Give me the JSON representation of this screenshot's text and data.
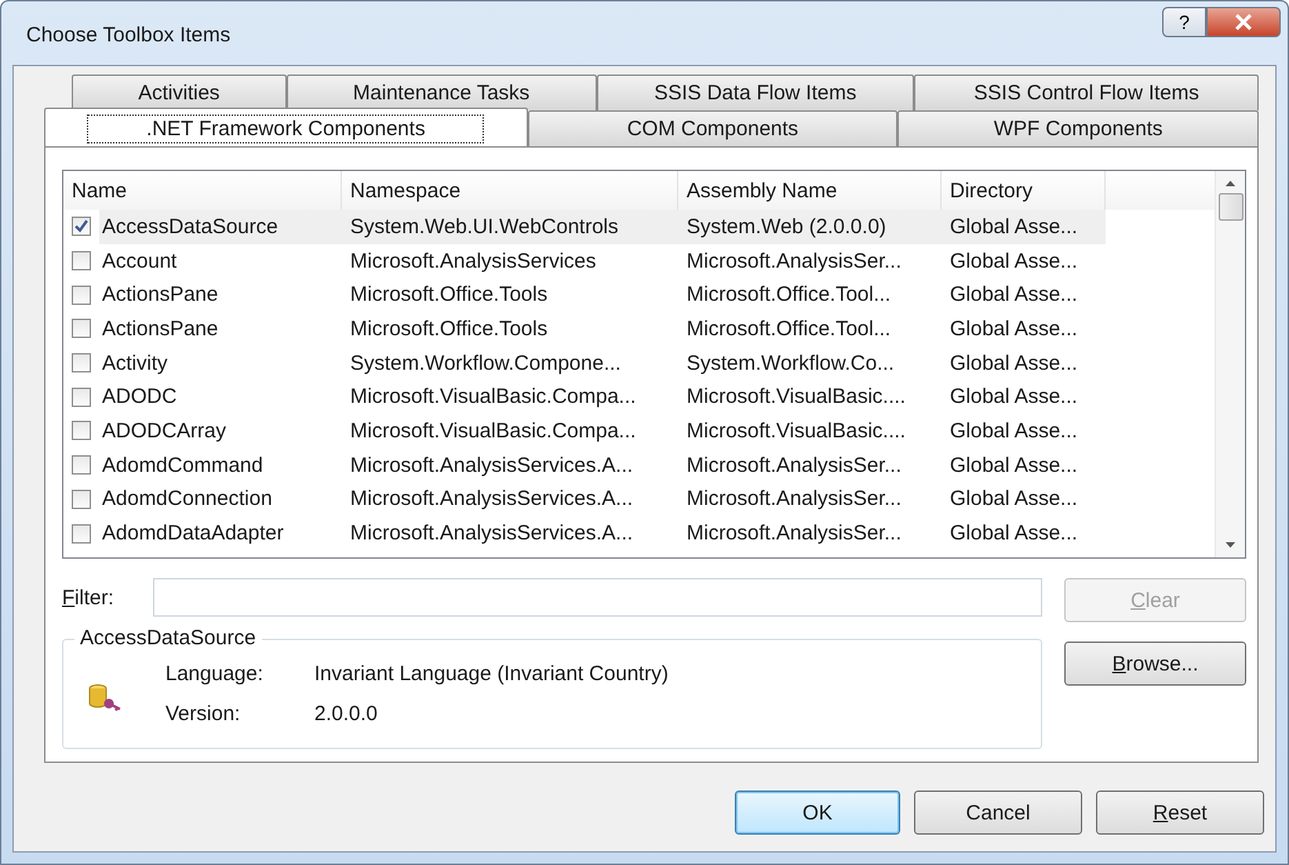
{
  "window": {
    "title": "Choose Toolbox Items",
    "help_button": "?"
  },
  "tab_rows": [
    [
      {
        "label": "Activities",
        "selected": false
      },
      {
        "label": "Maintenance Tasks",
        "selected": false
      },
      {
        "label": "SSIS Data Flow Items",
        "selected": false
      },
      {
        "label": "SSIS Control Flow Items",
        "selected": false
      }
    ],
    [
      {
        "label": ".NET Framework Components",
        "selected": true
      },
      {
        "label": "COM Components",
        "selected": false
      },
      {
        "label": "WPF Components",
        "selected": false
      }
    ]
  ],
  "table": {
    "columns": [
      "Name",
      "Namespace",
      "Assembly Name",
      "Directory"
    ],
    "rows": [
      {
        "cells": [
          "AccessDataSource",
          "System.Web.UI.WebControls",
          "System.Web (2.0.0.0)",
          "Global Asse..."
        ],
        "checked": true,
        "selected": true
      },
      {
        "cells": [
          "Account",
          "Microsoft.AnalysisServices",
          "Microsoft.AnalysisSer...",
          "Global Asse..."
        ],
        "checked": false,
        "selected": false
      },
      {
        "cells": [
          "ActionsPane",
          "Microsoft.Office.Tools",
          "Microsoft.Office.Tool...",
          "Global Asse..."
        ],
        "checked": false,
        "selected": false
      },
      {
        "cells": [
          "ActionsPane",
          "Microsoft.Office.Tools",
          "Microsoft.Office.Tool...",
          "Global Asse..."
        ],
        "checked": false,
        "selected": false
      },
      {
        "cells": [
          "Activity",
          "System.Workflow.Compone...",
          "System.Workflow.Co...",
          "Global Asse..."
        ],
        "checked": false,
        "selected": false
      },
      {
        "cells": [
          "ADODC",
          "Microsoft.VisualBasic.Compa...",
          "Microsoft.VisualBasic....",
          "Global Asse..."
        ],
        "checked": false,
        "selected": false
      },
      {
        "cells": [
          "ADODCArray",
          "Microsoft.VisualBasic.Compa...",
          "Microsoft.VisualBasic....",
          "Global Asse..."
        ],
        "checked": false,
        "selected": false
      },
      {
        "cells": [
          "AdomdCommand",
          "Microsoft.AnalysisServices.A...",
          "Microsoft.AnalysisSer...",
          "Global Asse..."
        ],
        "checked": false,
        "selected": false
      },
      {
        "cells": [
          "AdomdConnection",
          "Microsoft.AnalysisServices.A...",
          "Microsoft.AnalysisSer...",
          "Global Asse..."
        ],
        "checked": false,
        "selected": false
      },
      {
        "cells": [
          "AdomdDataAdapter",
          "Microsoft.AnalysisServices.A...",
          "Microsoft.AnalysisSer...",
          "Global Asse..."
        ],
        "checked": false,
        "selected": false
      }
    ]
  },
  "filter": {
    "label": "Filter:"
  },
  "clear_button": {
    "label": "Clear",
    "disabled": true
  },
  "browse_button": {
    "label": "Browse..."
  },
  "details": {
    "title": "AccessDataSource",
    "fields": [
      {
        "label": "Language:",
        "value": "Invariant Language (Invariant Country)"
      },
      {
        "label": "Version:",
        "value": "2.0.0.0"
      }
    ]
  },
  "buttons": [
    {
      "label": "OK",
      "default": true,
      "access_key": false
    },
    {
      "label": "Cancel",
      "default": false,
      "access_key": false
    },
    {
      "label": "Reset",
      "default": false,
      "access_key": true
    }
  ]
}
